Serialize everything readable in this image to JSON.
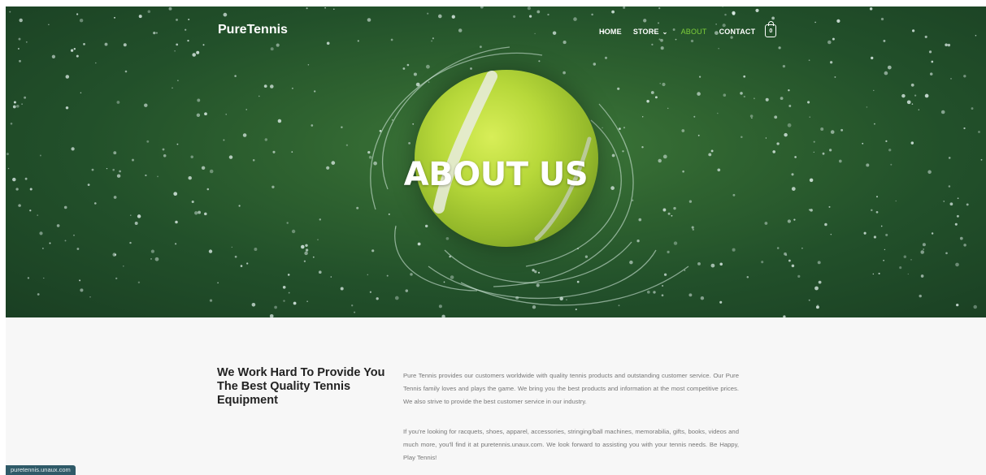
{
  "site": {
    "brand": "PureTennis"
  },
  "nav": {
    "items": [
      {
        "label": "HOME",
        "active": false,
        "dropdown": false
      },
      {
        "label": "STORE",
        "active": false,
        "dropdown": true
      },
      {
        "label": "ABOUT",
        "active": true,
        "dropdown": false
      },
      {
        "label": "CONTACT",
        "active": false,
        "dropdown": false
      }
    ],
    "cart_count": "0"
  },
  "hero": {
    "title": "ABOUT US"
  },
  "about": {
    "heading": "We Work Hard To Provide You The Best Quality Tennis Equipment",
    "paragraph_1": "Pure Tennis provides our customers worldwide with quality tennis products and outstanding customer service. Our Pure Tennis family loves and plays the game. We bring you the best products and information at the most competitive prices. We also strive to provide the best customer service in our industry.",
    "paragraph_2": "If you're looking for racquets, shoes, apparel, accessories, stringing/ball machines, memorabilia, gifts, books, videos and much more, you'll find it at puretennis.unaux.com. We look forward to assisting you with your tennis needs. Be Happy, Play Tennis!"
  },
  "status_bar": {
    "url": "puretennis.unaux.com"
  },
  "colors": {
    "accent": "#7fcf3a",
    "hero_green": "#2f6330",
    "heading": "#222222",
    "body_text": "#777777"
  }
}
